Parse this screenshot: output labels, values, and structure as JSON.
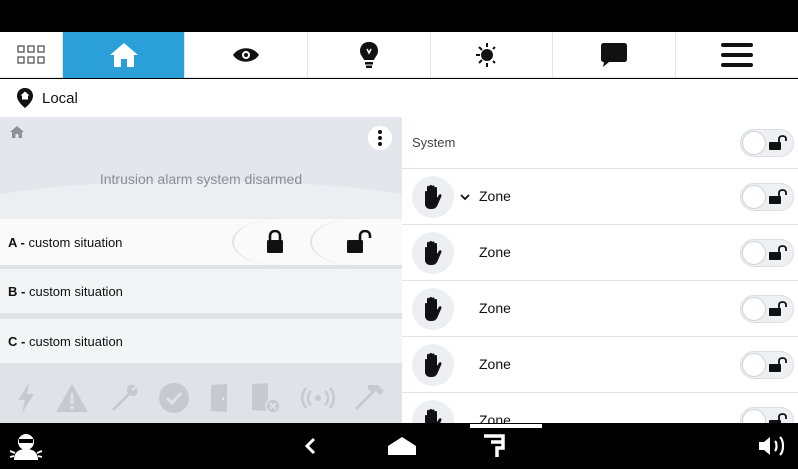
{
  "tabs": [
    {
      "icon": "grid-icon",
      "active": false
    },
    {
      "icon": "home-icon",
      "active": true
    },
    {
      "icon": "eye-icon",
      "active": false
    },
    {
      "icon": "lightbulb-icon",
      "active": false
    },
    {
      "icon": "sun-moon-icon",
      "active": false
    },
    {
      "icon": "chat-icon",
      "active": false
    },
    {
      "icon": "hamburger-menu-icon",
      "active": false
    }
  ],
  "location": {
    "icon": "location-pin-icon",
    "name": "Local"
  },
  "alarm": {
    "status": "Intrusion alarm system disarmed",
    "situations": [
      {
        "letter": "A - ",
        "name": "custom situation"
      },
      {
        "letter": "B - ",
        "name": "custom situation"
      },
      {
        "letter": "C - ",
        "name": "custom situation"
      }
    ],
    "status_icons": [
      "power-icon",
      "warning-icon",
      "wrench-icon",
      "check-circle-icon",
      "door-icon",
      "door-blocked-icon",
      "signal-icon",
      "hammer-icon"
    ]
  },
  "system_row": {
    "label": "System"
  },
  "zones": [
    {
      "label": "Zone",
      "expandable": true
    },
    {
      "label": "Zone",
      "expandable": false
    },
    {
      "label": "Zone",
      "expandable": false
    },
    {
      "label": "Zone",
      "expandable": false
    },
    {
      "label": "Zone",
      "expandable": false
    }
  ],
  "bottom": {
    "left_icon": "intruder-alert-icon",
    "back_icon": "back-chevron-icon",
    "home_icon": "home-shape-icon",
    "recent_icon": "recent-apps-icon",
    "volume_icon": "volume-icon"
  },
  "colors": {
    "accent": "#2a9fd8",
    "panel": "#dfe2e7"
  }
}
